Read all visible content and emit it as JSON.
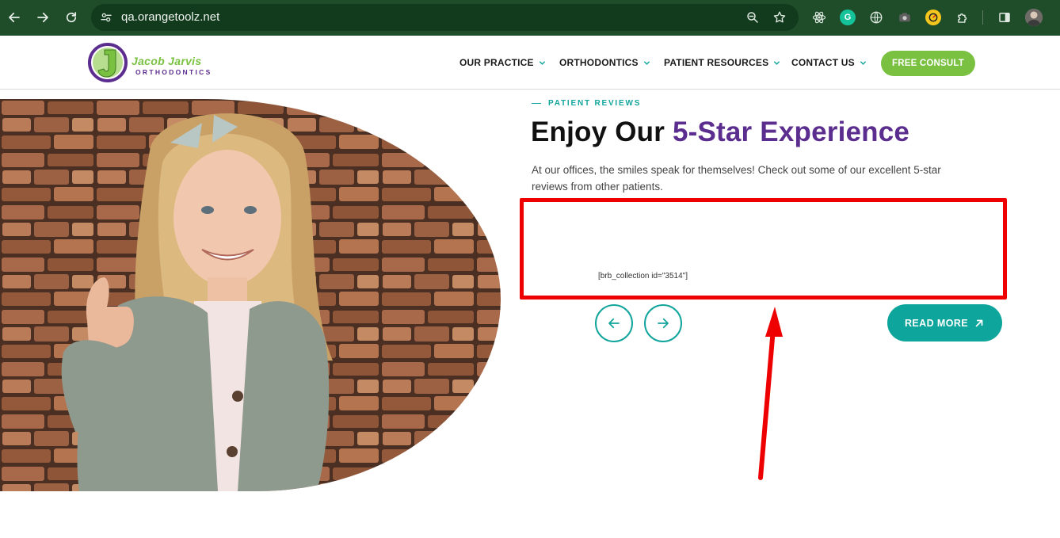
{
  "browser": {
    "url": "qa.orangetoolz.net",
    "back_icon": "arrow-left-icon",
    "forward_icon": "arrow-right-icon",
    "reload_icon": "reload-icon",
    "extensions": [
      "react-icon",
      "grammarly-icon",
      "globe-icon",
      "camera-icon",
      "timer-icon",
      "puzzle-icon",
      "sidepanel-icon",
      "profile-avatar"
    ]
  },
  "header": {
    "logo_name": "Jacob Jarvis",
    "logo_sub": "ORTHODONTICS",
    "nav": [
      {
        "label": "OUR PRACTICE"
      },
      {
        "label": "ORTHODONTICS"
      },
      {
        "label": "PATIENT RESOURCES"
      },
      {
        "label": "CONTACT US"
      }
    ],
    "cta": "FREE CONSULT"
  },
  "reviews": {
    "eyebrow": "PATIENT REVIEWS",
    "heading_plain": "Enjoy Our ",
    "heading_accent": "5-Star Experience",
    "intro": "At our offices, the smiles speak for themselves! Check out some of our excellent 5-star reviews from other patients.",
    "shortcode": "[brb_collection id=\"3514\"]",
    "prev_icon": "arrow-left-icon",
    "next_icon": "arrow-right-icon",
    "read_more": "READ MORE"
  },
  "colors": {
    "brand_green": "#7ac142",
    "brand_purple": "#5b2d8e",
    "teal": "#12a59c",
    "browser_bg": "#1f4d2a",
    "annotation_red": "#ee0000"
  }
}
